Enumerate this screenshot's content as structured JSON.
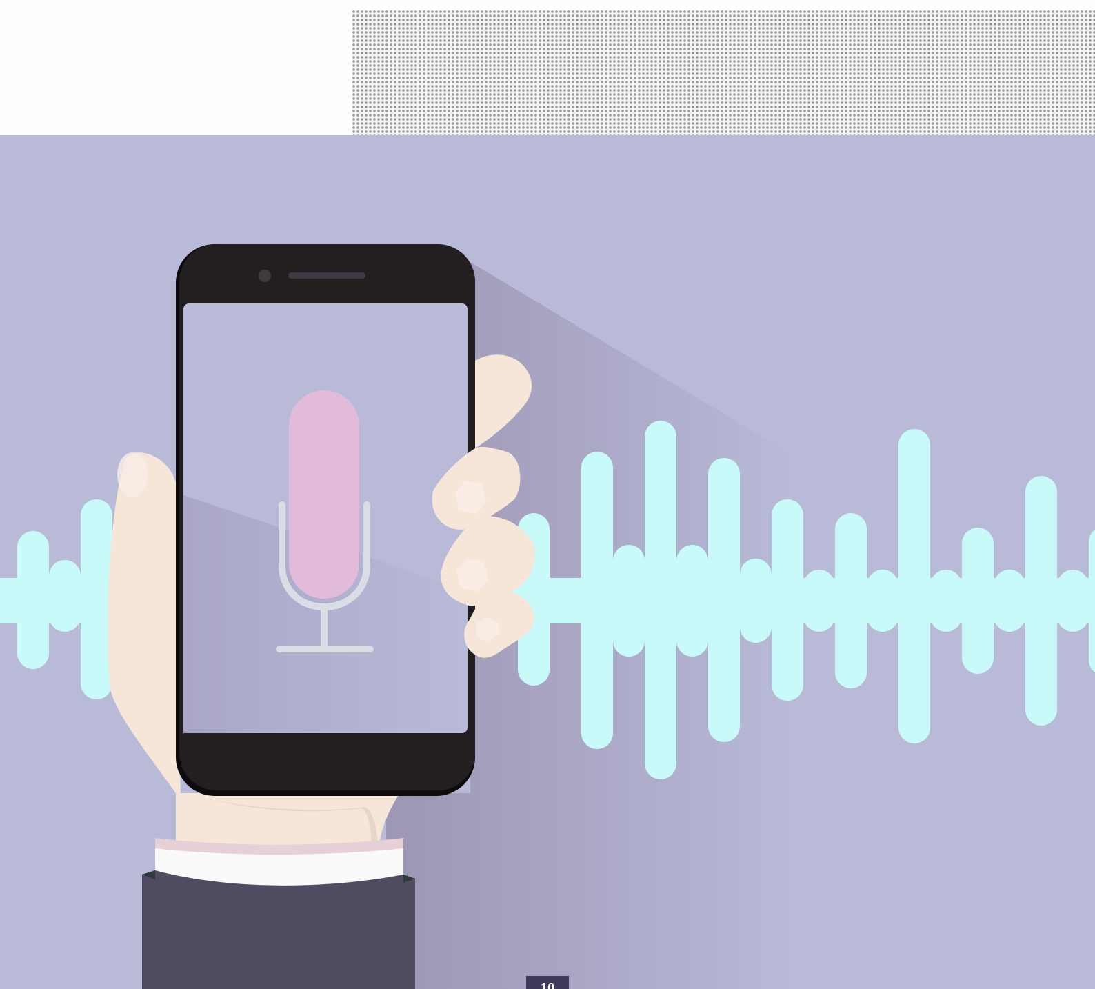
{
  "page_number": "10",
  "colors": {
    "background": "#b8bad8",
    "wave": "#c8fafa",
    "phone_body": "#231f20",
    "phone_screen": "#b8bad8",
    "microphone_capsule": "#e3bbda",
    "microphone_stand": "#d8dde6",
    "skin": "#f6e6d8",
    "sleeve": "#4f4c62",
    "cuff": "#fafafa",
    "page_tab": "#3e3a5c"
  },
  "icons": [
    "microphone-icon",
    "smartphone",
    "hand",
    "sound-wave"
  ]
}
